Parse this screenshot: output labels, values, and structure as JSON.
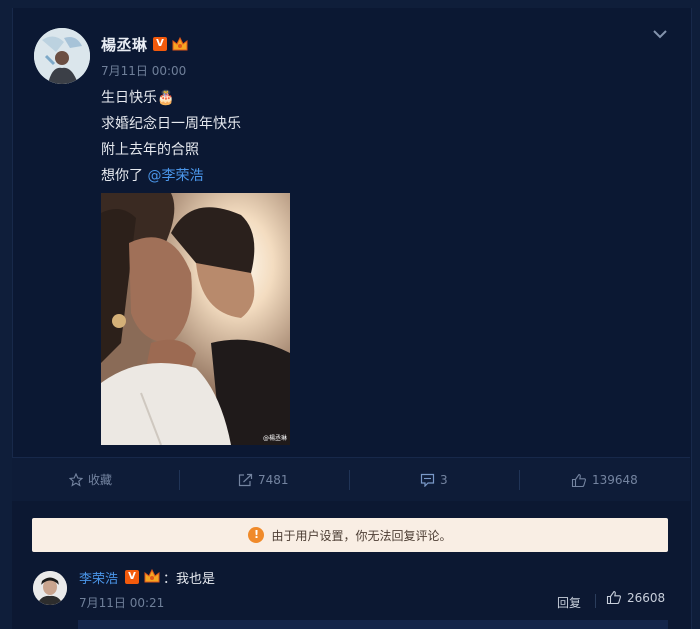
{
  "post": {
    "author": "楊丞琳",
    "time": "7月11日 00:00",
    "lines": [
      "生日快乐🎂",
      "求婚纪念日一周年快乐",
      "附上去年的合照"
    ],
    "last_line_prefix": "想你了 ",
    "mention": "@李荣浩",
    "photo_watermark": "@楊丞琳"
  },
  "actions": {
    "favorite": "收藏",
    "repost": "7481",
    "comment": "3",
    "like": "139648"
  },
  "notice": {
    "text": "由于用户设置，你无法回复评论。"
  },
  "comment": {
    "name": "李荣浩",
    "text": "：我也是",
    "time": "7月11日 00:21",
    "reply": "回复",
    "likes": "26608"
  },
  "colors": {
    "background": "#0b1833",
    "link": "#4a95e8",
    "verified_badge": "#f35a0c",
    "notice_bg": "#f9eee4"
  },
  "icons": [
    "chevron-down-icon",
    "star-icon",
    "share-icon",
    "comment-icon",
    "thumbs-up-icon",
    "warning-icon",
    "verified-icon",
    "crown-icon"
  ]
}
